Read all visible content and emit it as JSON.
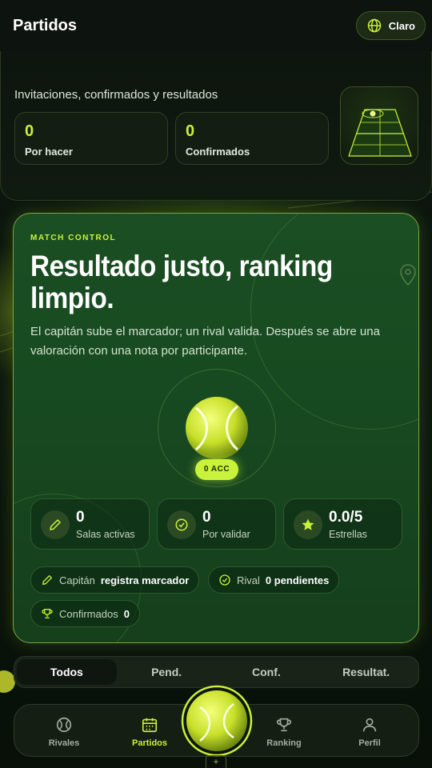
{
  "header": {
    "title": "Partidos",
    "theme_label": "Claro"
  },
  "summary": {
    "subtitle": "Invitaciones, confirmados y resultados",
    "stats": [
      {
        "value": "0",
        "label": "Por hacer"
      },
      {
        "value": "0",
        "label": "Confirmados"
      }
    ]
  },
  "match_control": {
    "eyebrow": "MATCH CONTROL",
    "title": "Resultado justo, ranking limpio.",
    "description": "El capitán sube el marcador; un rival valida. Después se abre una valoración con una nota por participante.",
    "badge": "0 ACC",
    "metrics": [
      {
        "value": "0",
        "label": "Salas activas",
        "icon": "pencil-icon"
      },
      {
        "value": "0",
        "label": "Por validar",
        "icon": "check-circle-icon"
      },
      {
        "value": "0.0/5",
        "label": "Estrellas",
        "icon": "star-icon"
      }
    ],
    "chips": [
      {
        "key": "Capitán",
        "value": "registra marcador",
        "icon": "pencil-icon"
      },
      {
        "key": "Rival",
        "value": "0 pendientes",
        "icon": "check-circle-icon"
      },
      {
        "key": "Confirmados",
        "value": "0",
        "icon": "trophy-icon"
      }
    ]
  },
  "filter_tabs": [
    {
      "label": "Todos",
      "active": true
    },
    {
      "label": "Pend.",
      "active": false
    },
    {
      "label": "Conf.",
      "active": false
    },
    {
      "label": "Resultat.",
      "active": false
    }
  ],
  "bottom_nav": [
    {
      "label": "Rivales",
      "icon": "ball-icon",
      "active": false
    },
    {
      "label": "Partidos",
      "icon": "calendar-icon",
      "active": true
    },
    {
      "label": "Ranking",
      "icon": "trophy-icon",
      "active": false
    },
    {
      "label": "Perfil",
      "icon": "user-icon",
      "active": false
    }
  ],
  "colors": {
    "accent": "#c9f23a",
    "card_green": "#1b4e23",
    "background": "#0a120c"
  }
}
